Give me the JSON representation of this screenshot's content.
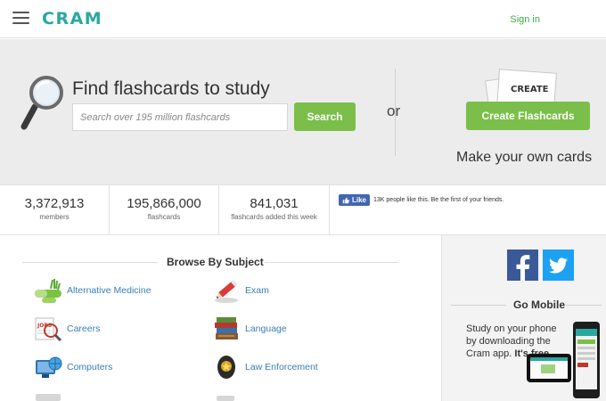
{
  "header": {
    "logo": "CRAM",
    "signin": "Sign in"
  },
  "hero": {
    "title": "Find flashcards to study",
    "search_placeholder": "Search over 195 million flashcards",
    "search_button": "Search",
    "or": "or",
    "create_card_label": "CREATE",
    "create_button": "Create Flashcards",
    "make_own": "Make your own cards"
  },
  "stats": [
    {
      "value": "3,372,913",
      "label": "members"
    },
    {
      "value": "195,866,000",
      "label": "flashcards"
    },
    {
      "value": "841,031",
      "label": "flashcards added this week"
    }
  ],
  "facebook": {
    "like_label": "Like",
    "like_text": "13K people like this. Be the first of your friends."
  },
  "browse": {
    "title": "Browse By Subject",
    "subjects": [
      {
        "label": "Alternative Medicine",
        "icon": "herbal-pills-icon"
      },
      {
        "label": "Exam",
        "icon": "pencil-exam-icon"
      },
      {
        "label": "Careers",
        "icon": "jobs-search-icon"
      },
      {
        "label": "Language",
        "icon": "books-stack-icon"
      },
      {
        "label": "Computers",
        "icon": "computer-globe-icon"
      },
      {
        "label": "Law Enforcement",
        "icon": "police-badge-icon"
      }
    ]
  },
  "sidebar": {
    "go_mobile": "Go Mobile",
    "study_text": "Study on your phone by downloading the Cram app.",
    "free_text": "It's free."
  },
  "colors": {
    "brand": "#2aa8a0",
    "button_green": "#7bbf4a",
    "link_blue": "#3a7fb5",
    "facebook": "#3b5998",
    "twitter": "#1da1f2"
  }
}
